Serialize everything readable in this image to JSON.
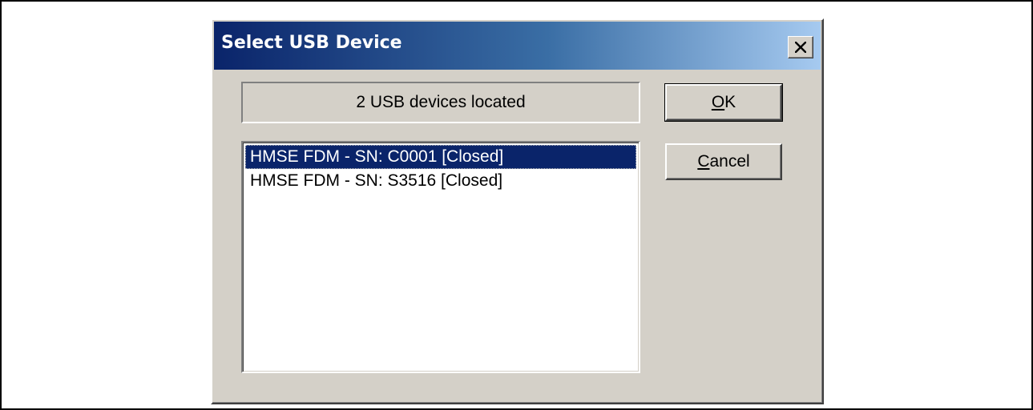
{
  "window": {
    "title": "Select USB Device",
    "close_icon": "close-icon"
  },
  "status": {
    "text": "2 USB devices located"
  },
  "device_list": {
    "items": [
      {
        "label": "HMSE FDM - SN: C0001  [Closed]",
        "selected": true
      },
      {
        "label": "HMSE FDM - SN: S3516  [Closed]",
        "selected": false
      }
    ]
  },
  "buttons": {
    "ok": {
      "mnemonic": "O",
      "rest": "K"
    },
    "cancel": {
      "mnemonic": "C",
      "rest": "ancel"
    }
  },
  "colors": {
    "titlebar_start": "#0a246a",
    "titlebar_end": "#a6caf0",
    "dialog_face": "#d4d0c8",
    "selection": "#0a246a"
  }
}
